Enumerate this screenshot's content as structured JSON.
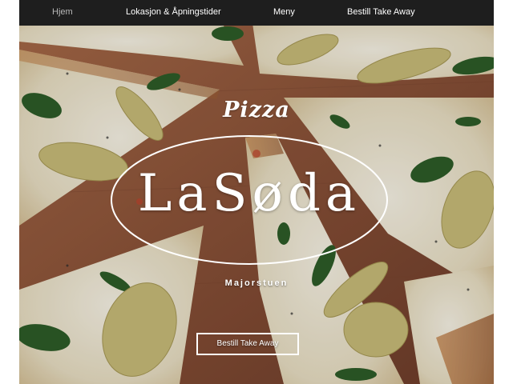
{
  "nav": {
    "items": [
      {
        "label": "Hjem",
        "active": true
      },
      {
        "label": "Lokasjon & Åpningstider",
        "active": false
      },
      {
        "label": "Meny",
        "active": false
      },
      {
        "label": "Bestill Take Away",
        "active": false
      }
    ]
  },
  "hero": {
    "logo_top": "Pizza",
    "logo_name": "LaSøda",
    "location": "Majorstuen",
    "cta_label": "Bestill Take Away"
  },
  "colors": {
    "nav_background": "#1e1e1e",
    "nav_text": "#ffffff",
    "nav_active_text": "#b9b9b9",
    "overlay_text": "#ffffff"
  }
}
